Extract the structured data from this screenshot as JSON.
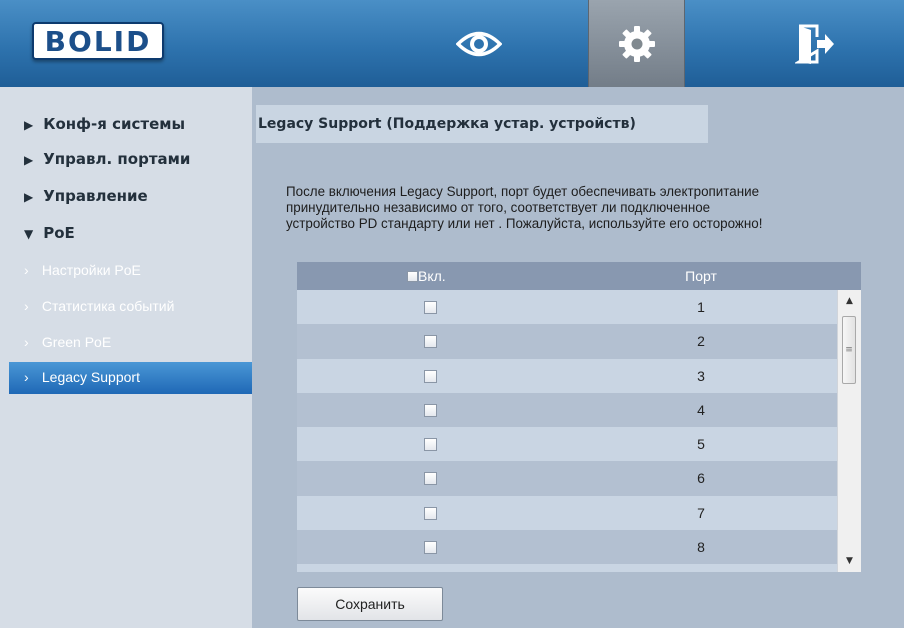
{
  "header": {
    "logo_text": "BOLID",
    "icons": [
      "eye-icon",
      "gear-icon",
      "exit-icon"
    ],
    "active_icon": "gear-icon",
    "colors": {
      "header_bg": "#2e73ae",
      "active_bg": "#8a949e"
    }
  },
  "sidebar": {
    "sections": [
      {
        "label": "Конф-я системы",
        "expanded": false
      },
      {
        "label": "Управл. портами",
        "expanded": false
      },
      {
        "label": "Управление",
        "expanded": false
      },
      {
        "label": "PoE",
        "expanded": true
      }
    ],
    "sub_items": [
      {
        "label": "Настройки PoE"
      },
      {
        "label": "Статистика событий"
      },
      {
        "label": "Green PoE"
      },
      {
        "label": "Legacy Support"
      }
    ],
    "selected": "Legacy Support"
  },
  "main": {
    "title": "Legacy Support (Поддержка устар. устройств)",
    "description_lines": [
      "После включения Legacy Support, порт будет обеспечивать электропитание",
      "принудительно независимо от того, соответствует ли подключенное",
      "устройство PD стандарту или нет . Пожалуйста, используйте его осторожно!"
    ],
    "table": {
      "col_enable": "Вкл.",
      "col_port": "Порт",
      "rows": [
        {
          "port": "1",
          "enabled": false
        },
        {
          "port": "2",
          "enabled": false
        },
        {
          "port": "3",
          "enabled": false
        },
        {
          "port": "4",
          "enabled": false
        },
        {
          "port": "5",
          "enabled": false
        },
        {
          "port": "6",
          "enabled": false
        },
        {
          "port": "7",
          "enabled": false
        },
        {
          "port": "8",
          "enabled": false
        }
      ]
    },
    "save_label": "Сохранить"
  }
}
